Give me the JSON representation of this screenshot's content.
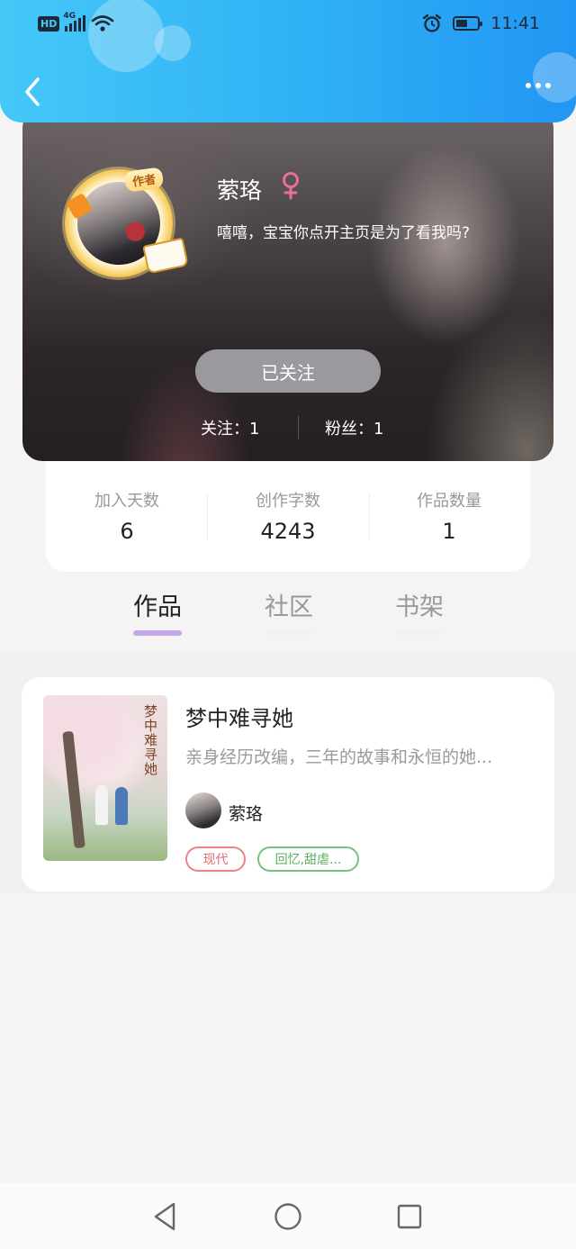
{
  "status_bar": {
    "hd_label": "HD",
    "network": "4G",
    "time": "11:41"
  },
  "profile": {
    "author_badge": "作者",
    "username": "萦珞",
    "gender_symbol": "♀",
    "bio": "嘻嘻，宝宝你点开主页是为了看我吗?",
    "follow_button": "已关注",
    "following_label": "关注：1",
    "fans_label": "粉丝：1"
  },
  "stats": [
    {
      "label": "加入天数",
      "value": "6"
    },
    {
      "label": "创作字数",
      "value": "4243"
    },
    {
      "label": "作品数量",
      "value": "1"
    }
  ],
  "tabs": [
    {
      "label": "作品",
      "active": true
    },
    {
      "label": "社区",
      "active": false
    },
    {
      "label": "书架",
      "active": false
    }
  ],
  "works": [
    {
      "cover_title": "梦中难寻她",
      "title": "梦中难寻她",
      "description": "亲身经历改编，三年的故事和永恒的她...",
      "author": "萦珞",
      "tags": [
        "现代",
        "回忆,甜虐..."
      ]
    }
  ],
  "colors": {
    "header_gradient_start": "#45c8f7",
    "header_gradient_end": "#2196f3",
    "tab_active_underline": "#c5a6e8",
    "follow_button": "#9a999e",
    "female_icon": "#e76f9c",
    "tag_red": "#e26a70",
    "tag_green": "#5bb062"
  },
  "icons": {
    "back": "chevron-left-icon",
    "more": "more-horizontal-icon",
    "gender": "female-icon",
    "alarm": "alarm-icon",
    "wifi": "wifi-icon",
    "nav_back": "triangle-back-icon",
    "nav_home": "circle-home-icon",
    "nav_recents": "square-recents-icon"
  }
}
